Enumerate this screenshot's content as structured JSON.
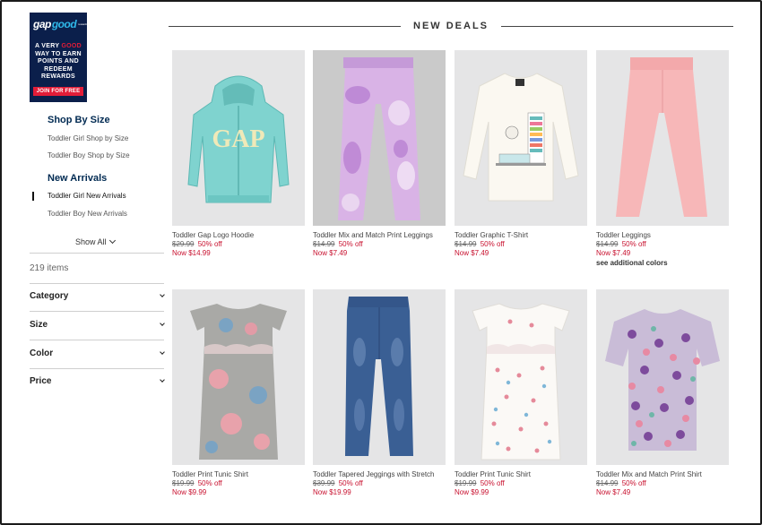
{
  "promo": {
    "logo_gap": "gap",
    "logo_good": "good",
    "logo_sub": "rewards",
    "line1": "A VERY",
    "line1_hl": "GOOD",
    "line2": "WAY TO EARN",
    "line3": "POINTS AND",
    "line4": "REDEEM",
    "line5": "REWARDS",
    "button": "JOIN FOR FREE"
  },
  "sidebar": {
    "shop_by_size_title": "Shop By Size",
    "shop_by_size_links": [
      "Toddler Girl Shop by Size",
      "Toddler Boy Shop by Size"
    ],
    "new_arrivals_title": "New Arrivals",
    "new_arrivals_links": [
      "Toddler Girl New Arrivals",
      "Toddler Boy New Arrivals"
    ],
    "show_all": "Show All",
    "items_count": "219 items",
    "filters": [
      "Category",
      "Size",
      "Color",
      "Price"
    ]
  },
  "header": {
    "title": "NEW DEALS"
  },
  "products": [
    {
      "name": "Toddler Gap Logo Hoodie",
      "orig": "$29.99",
      "pct": "50% off",
      "now": "Now $14.99",
      "more": ""
    },
    {
      "name": "Toddler Mix and Match Print Leggings",
      "orig": "$14.99",
      "pct": "50% off",
      "now": "Now $7.49",
      "more": ""
    },
    {
      "name": "Toddler Graphic T-Shirt",
      "orig": "$14.99",
      "pct": "50% off",
      "now": "Now $7.49",
      "more": ""
    },
    {
      "name": "Toddler Leggings",
      "orig": "$14.99",
      "pct": "50% off",
      "now": "Now $7.49",
      "more": "see additional colors"
    },
    {
      "name": "Toddler Print Tunic Shirt",
      "orig": "$19.99",
      "pct": "50% off",
      "now": "Now $9.99",
      "more": ""
    },
    {
      "name": "Toddler Tapered Jeggings with Stretch",
      "orig": "$39.99",
      "pct": "50% off",
      "now": "Now $19.99",
      "more": ""
    },
    {
      "name": "Toddler Print Tunic Shirt",
      "orig": "$19.99",
      "pct": "50% off",
      "now": "Now $9.99",
      "more": ""
    },
    {
      "name": "Toddler Mix and Match Print Shirt",
      "orig": "$14.99",
      "pct": "50% off",
      "now": "Now $7.49",
      "more": ""
    }
  ],
  "colors": {
    "brand_navy": "#0b1f4b",
    "sale_red": "#c8102e",
    "image_bg": "#e5e5e6"
  }
}
